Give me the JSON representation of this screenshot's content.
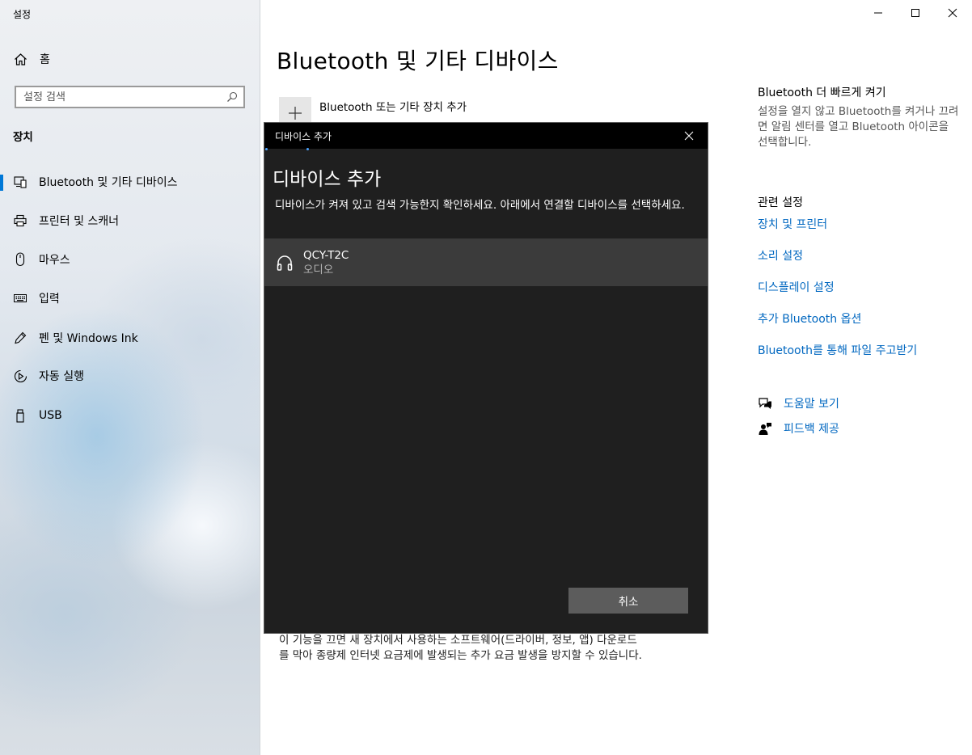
{
  "window": {
    "title": "설정"
  },
  "sidebar": {
    "home_label": "홈",
    "search_placeholder": "설정 검색",
    "section_label": "장치",
    "items": [
      {
        "label": "Bluetooth 및 기타 디바이스",
        "icon": "bluetooth-devices-icon",
        "active": true
      },
      {
        "label": "프린터 및 스캐너",
        "icon": "printer-icon"
      },
      {
        "label": "마우스",
        "icon": "mouse-icon"
      },
      {
        "label": "입력",
        "icon": "keyboard-icon"
      },
      {
        "label": "펜 및 Windows Ink",
        "icon": "pen-icon"
      },
      {
        "label": "자동 실행",
        "icon": "autoplay-icon"
      },
      {
        "label": "USB",
        "icon": "usb-icon"
      }
    ]
  },
  "main": {
    "title": "Bluetooth 및 기타 디바이스",
    "add_device_label": "Bluetooth 또는 기타 장치 추가",
    "bottom_text": "이 기능을 끄면 새 장치에서 사용하는 소프트웨어(드라이버, 정보, 앱) 다운로드를 막아 종량제 인터넷 요금제에 발생되는 추가 요금 발생을 방지할 수 있습니다."
  },
  "right": {
    "quick_title": "Bluetooth 더 빠르게 켜기",
    "quick_desc": "설정을 열지 않고 Bluetooth를 켜거나 끄려면 알림 센터를 열고 Bluetooth 아이콘을 선택합니다.",
    "related_title": "관련 설정",
    "links": [
      "장치 및 프린터",
      "소리 설정",
      "디스플레이 설정",
      "추가 Bluetooth 옵션",
      "Bluetooth를 통해 파일 주고받기"
    ],
    "help_label": "도움말 보기",
    "feedback_label": "피드백 제공"
  },
  "dialog": {
    "title": "디바이스 추가",
    "heading": "디바이스 추가",
    "description": "디바이스가 켜져 있고 검색 가능한지 확인하세요. 아래에서 연결할 디바이스를 선택하세요.",
    "device": {
      "name": "QCY-T2C",
      "type": "오디오",
      "icon": "headphones-icon"
    },
    "cancel_label": "취소"
  },
  "colors": {
    "accent": "#0078d7",
    "link": "#0067c0",
    "dialog_bg": "#1f1f1f",
    "device_row": "#3b3b3b"
  }
}
